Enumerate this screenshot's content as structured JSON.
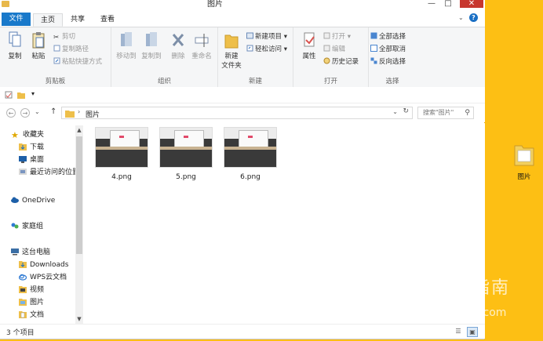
{
  "window": {
    "title": "图片"
  },
  "tabs": {
    "file": "文件",
    "home": "主页",
    "share": "共享",
    "view": "查看"
  },
  "ribbon": {
    "clipboard": {
      "label": "剪贴板",
      "copy": "复制",
      "paste": "粘贴",
      "cut": "剪切",
      "copy_path": "复制路径",
      "paste_shortcut": "粘贴快捷方式"
    },
    "organize": {
      "label": "组织",
      "move_to": "移动到",
      "copy_to": "复制到",
      "delete": "删除",
      "rename": "重命名"
    },
    "new": {
      "label": "新建",
      "new_folder": "新建\n文件夹",
      "new_folder_line1": "新建",
      "new_folder_line2": "文件夹",
      "new_item": "新建项目",
      "easy_access": "轻松访问"
    },
    "open": {
      "label": "打开",
      "properties": "属性",
      "open": "打开",
      "edit": "编辑",
      "history": "历史记录"
    },
    "select": {
      "label": "选择",
      "select_all": "全部选择",
      "select_none": "全部取消",
      "invert": "反向选择"
    }
  },
  "address": {
    "path": "图片",
    "search_placeholder": "搜索\"图片\""
  },
  "nav": {
    "favorites": "收藏夹",
    "downloads": "下载",
    "desktop": "桌面",
    "recent": "最近访问的位置",
    "onedrive": "OneDrive",
    "homegroup": "家庭组",
    "this_pc": "这台电脑",
    "downloads_en": "Downloads",
    "wps": "WPS云文档",
    "videos": "视频",
    "pictures": "图片",
    "documents": "文档"
  },
  "files": [
    {
      "name": "4.png"
    },
    {
      "name": "5.png"
    },
    {
      "name": "6.png"
    }
  ],
  "status": {
    "count": "3 个项目"
  },
  "desktop_icon": {
    "label": "图片"
  },
  "watermark": {
    "brand": "搜狗指南",
    "url": "zhinan.sogou.com"
  },
  "colors": {
    "accent": "#1979ca",
    "desktop": "#fdbf14",
    "close": "#c7372f"
  }
}
